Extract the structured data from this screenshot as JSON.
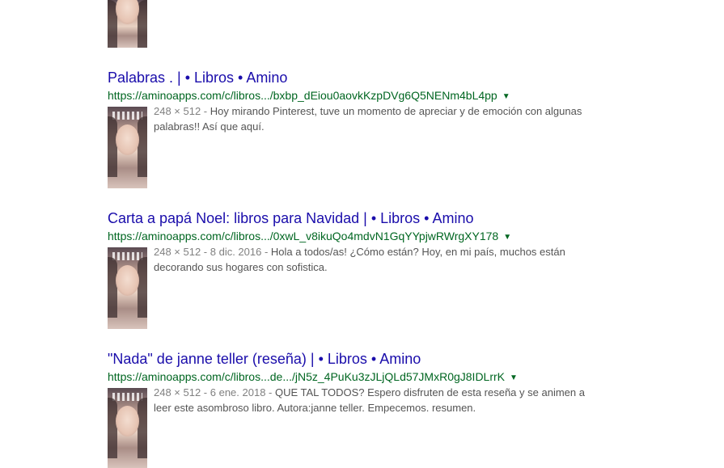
{
  "results": [
    {
      "title": "Palabras . | • Libros • Amino",
      "url": "https://aminoapps.com/c/libros.../bxbp_dEiou0aovkKzpDVg6Q5NENm4bL4pp",
      "caret": "▼",
      "meta": "248 × 512 - ",
      "snippet": "Hoy mirando Pinterest, tuve un momento de apreciar y de emoción con algunas palabras!! Así que aquí."
    },
    {
      "title": "Carta a papá Noel: libros para Navidad | • Libros • Amino",
      "url": "https://aminoapps.com/c/libros.../0xwL_v8ikuQo4mdvN1GqYYpjwRWrgXY178",
      "caret": "▼",
      "meta": "248 × 512 - 8 dic. 2016 - ",
      "snippet": "Hola a todos/as! ¿Cómo están? Hoy, en mi país, muchos están decorando sus hogares con sofistica."
    },
    {
      "title": "\"Nada\" de janne teller (reseña) | • Libros • Amino",
      "url": "https://aminoapps.com/c/libros...de.../jN5z_4PuKu3zJLjQLd57JMxR0gJ8IDLrrK",
      "caret": "▼",
      "meta": "248 × 512 - 6 ene. 2018 - ",
      "snippet": "QUE TAL TODOS? Espero disfruten de esta reseña y se animen a leer este asombroso libro. Autora:janne teller. Empecemos. resumen."
    }
  ]
}
